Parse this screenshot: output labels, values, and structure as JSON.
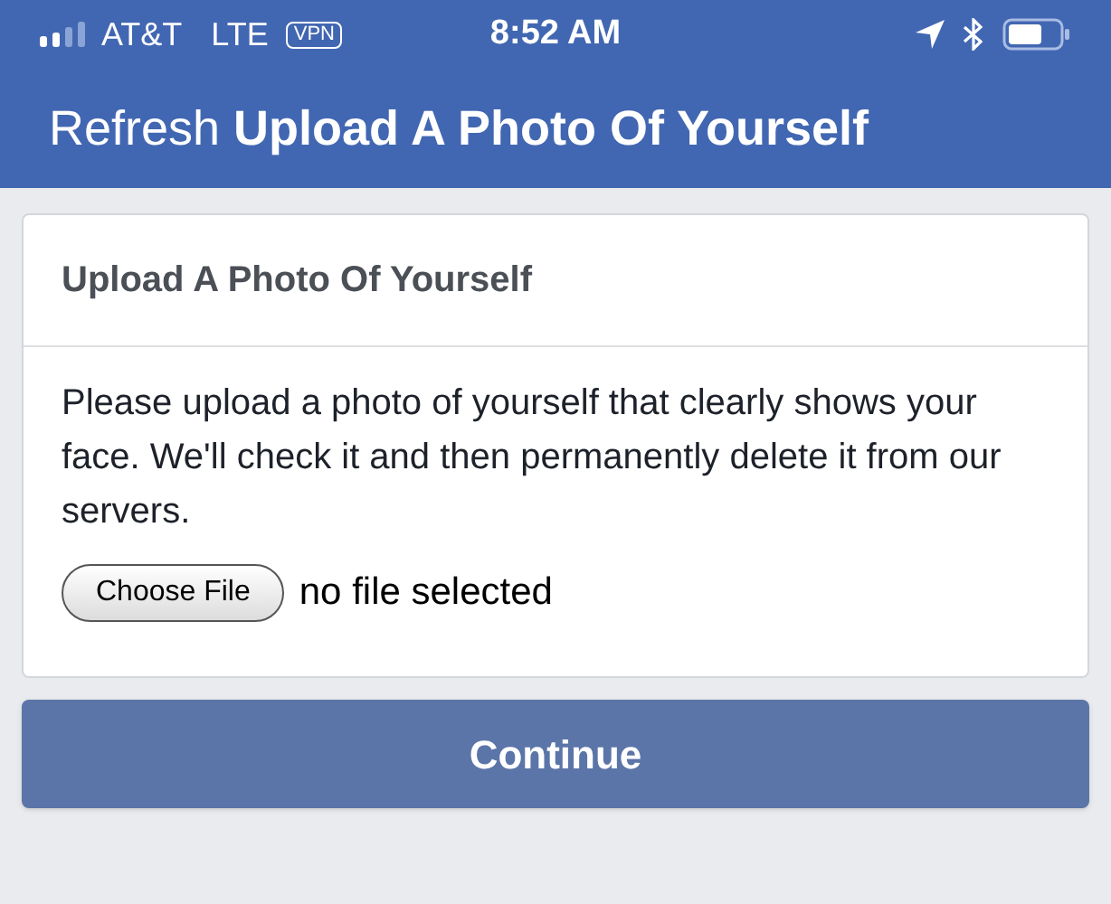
{
  "status_bar": {
    "carrier": "AT&T",
    "network": "LTE",
    "vpn": "VPN",
    "time": "8:52 AM"
  },
  "header": {
    "title": "Refresh **Upload A Photo Of Yourself**"
  },
  "card": {
    "title": "Upload A Photo Of Yourself",
    "message": "Please upload a photo of yourself that clearly shows your face. We'll check it and then permanently delete it from our servers.",
    "file_button": "Choose File",
    "file_status": "no file selected"
  },
  "continue_button": "Continue"
}
